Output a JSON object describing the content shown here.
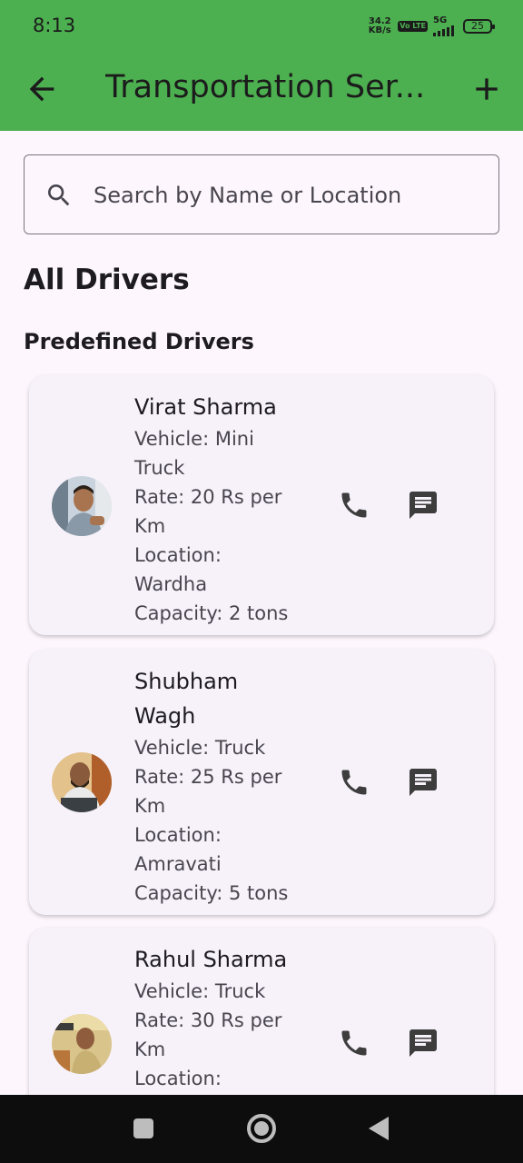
{
  "status_bar": {
    "time": "8:13",
    "net_speed_value": "34.2",
    "net_speed_unit": "KB/s",
    "volte_badge": "Vo LTE",
    "network_label": "5G",
    "battery": "25"
  },
  "app_bar": {
    "title": "Transportation Ser...",
    "back_icon": "arrow-back-icon",
    "add_icon": "add-icon"
  },
  "search": {
    "placeholder": "Search by Name or Location",
    "value": "",
    "icon": "search-icon"
  },
  "headings": {
    "all_drivers": "All Drivers",
    "predefined_drivers": "Predefined Drivers"
  },
  "drivers": [
    {
      "name": "Virat Sharma",
      "vehicle": [
        "Vehicle: Mini",
        "Truck"
      ],
      "rate": [
        "Rate: 20 Rs per",
        "Km"
      ],
      "location": [
        "Location:",
        "Wardha"
      ],
      "capacity": "Capacity: 2 tons"
    },
    {
      "name_lines": [
        "Shubham",
        "Wagh"
      ],
      "vehicle": "Vehicle: Truck",
      "rate": [
        "Rate: 25 Rs per",
        "Km"
      ],
      "location": [
        "Location:",
        "Amravati"
      ],
      "capacity": "Capacity: 5 tons"
    },
    {
      "name": "Rahul Sharma",
      "vehicle": "Vehicle: Truck",
      "rate": [
        "Rate: 30 Rs per",
        "Km"
      ],
      "location": [
        "Location:"
      ]
    }
  ],
  "colors": {
    "app_bar": "#4caf50",
    "background": "#fdf7fd",
    "card": "#f7f2fa",
    "icon": "#3d3d3d",
    "nav_bar": "#0d0d0d"
  }
}
